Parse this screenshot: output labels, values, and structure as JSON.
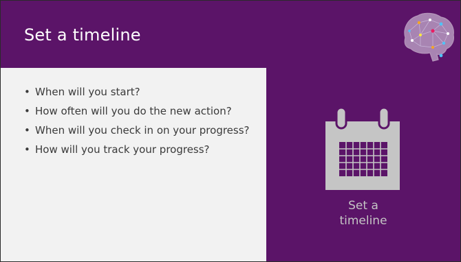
{
  "slide": {
    "title": "Set a timeline",
    "bullets": [
      "When will you start?",
      "How often will you do the new action?",
      "When will you check in on your progress?",
      "How will you track your progress?"
    ],
    "caption_line1": "Set a",
    "caption_line2": "timeline"
  },
  "icons": {
    "brain": "brain-network-icon",
    "calendar": "calendar-icon"
  },
  "colors": {
    "background": "#5b1468",
    "content_panel": "#f2f2f2",
    "text": "#3a3a3a",
    "icon_gray": "#c5c5c5"
  }
}
